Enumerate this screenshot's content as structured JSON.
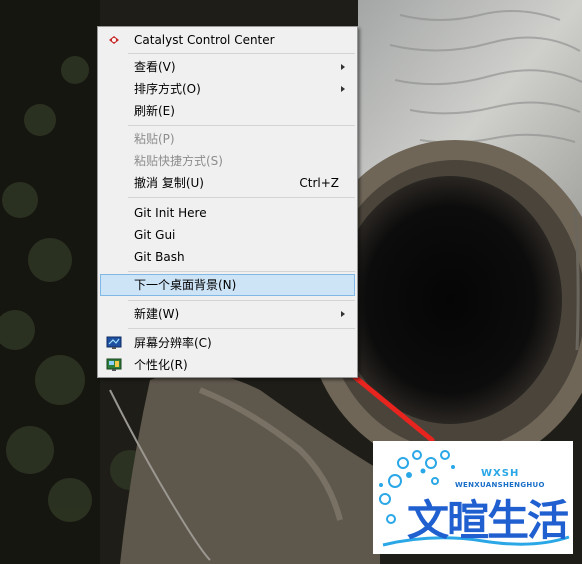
{
  "context_menu": {
    "items": [
      {
        "label": "Catalyst Control Center",
        "icon": "catalyst-icon"
      },
      {
        "label": "查看(V)",
        "submenu": true
      },
      {
        "label": "排序方式(O)",
        "submenu": true
      },
      {
        "label": "刷新(E)"
      },
      {
        "label": "粘贴(P)",
        "disabled": true
      },
      {
        "label": "粘贴快捷方式(S)",
        "disabled": true
      },
      {
        "label": "撤消 复制(U)",
        "shortcut": "Ctrl+Z"
      },
      {
        "label": "Git Init Here"
      },
      {
        "label": "Git Gui"
      },
      {
        "label": "Git Bash"
      },
      {
        "label": "下一个桌面背景(N)",
        "highlighted": true
      },
      {
        "label": "新建(W)",
        "submenu": true
      },
      {
        "label": "屏幕分辨率(C)",
        "icon": "display-icon"
      },
      {
        "label": "个性化(R)",
        "icon": "personalize-icon"
      }
    ]
  },
  "annotation": {
    "color": "#e8241f"
  },
  "watermark": {
    "title": "文暄生活",
    "subtitle": "WENXUANSHENGHUO",
    "badge": "WXSH"
  }
}
